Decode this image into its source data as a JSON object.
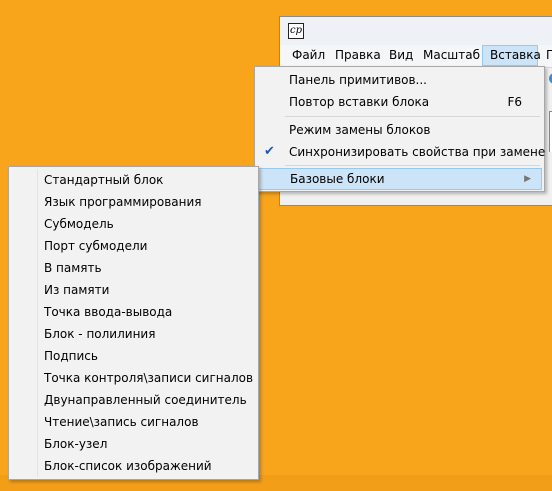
{
  "window": {
    "icon_glyph": "cp",
    "menubar": [
      "Файл",
      "Правка",
      "Вид",
      "Масштаб",
      "Вставка",
      "П"
    ],
    "open_menu_index": 4
  },
  "insert_menu": {
    "items": [
      {
        "label": "Панель примитивов...",
        "shortcut": ""
      },
      {
        "label": "Повтор вставки блока",
        "shortcut": "F6"
      },
      {
        "label": "Режим замены блоков",
        "shortcut": ""
      },
      {
        "label": "Синхронизировать свойства при замене",
        "shortcut": "",
        "checked": true,
        "check_glyph": "✔"
      },
      {
        "label": "Базовые блоки",
        "shortcut": "",
        "submenu": true,
        "arrow_glyph": "▶"
      }
    ]
  },
  "submenu": {
    "items": [
      "Стандартный блок",
      "Язык программирования",
      "Субмодель",
      "Порт субмодели",
      "В память",
      "Из памяти",
      "Точка ввода-вывода",
      "Блок - полилиния",
      "Подпись",
      "Точка контроля\\записи сигналов",
      "Двунаправленный соединитель",
      "Чтение\\запись сигналов",
      "Блок-узел",
      "Блок-список изображений"
    ]
  },
  "colors": {
    "desktop": "#f8a51c",
    "highlight": "#cce4f7",
    "highlight_border": "#99c9ef",
    "menu_bg": "#f2f2f2"
  }
}
